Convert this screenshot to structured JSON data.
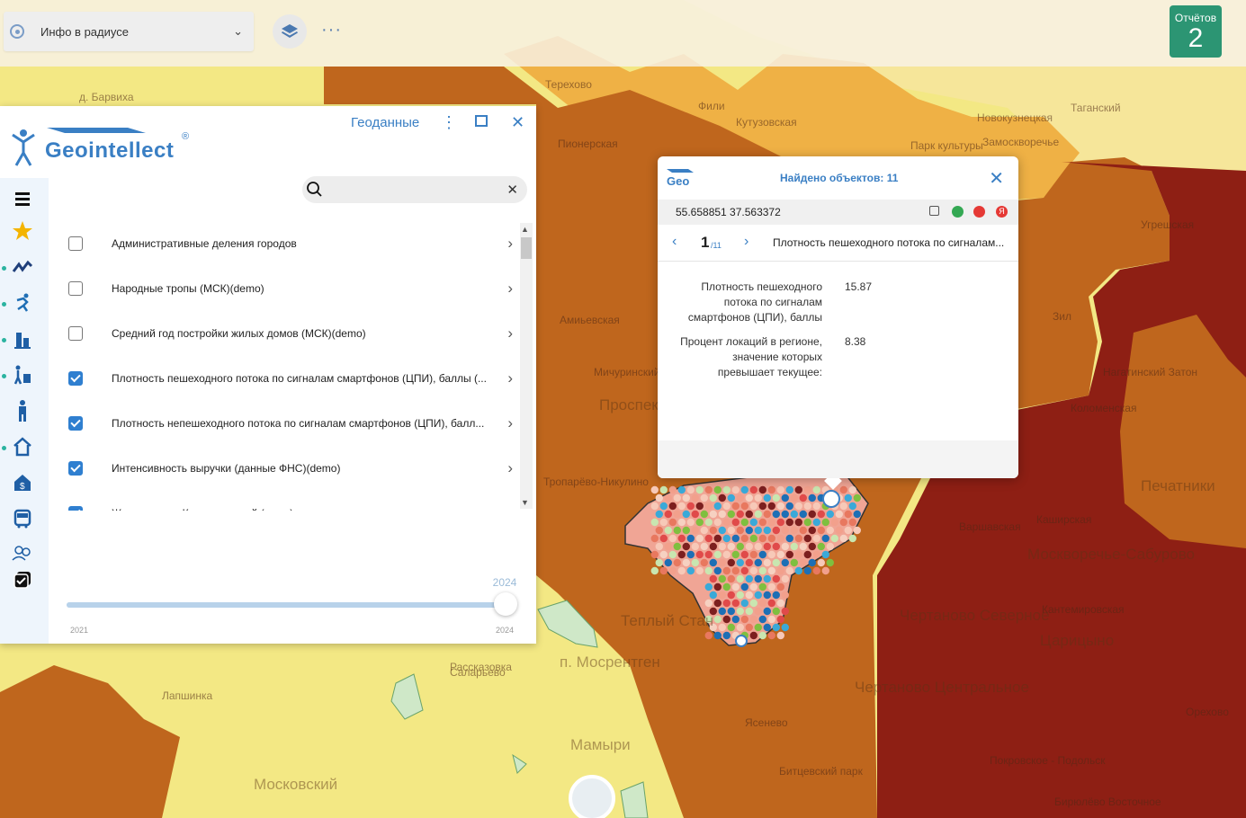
{
  "topbar": {
    "mode_select": {
      "value": "Инфо в радиусе"
    },
    "reports": {
      "label": "Отчётов",
      "count": "2"
    }
  },
  "map": {
    "labels": [
      "д. Барвиха",
      "Терехово",
      "Кутузовская",
      "Фили",
      "Пионерская",
      "Новокузнецкая",
      "Парк культуры",
      "Замоскворечье",
      "Таганский",
      "Амиьевская",
      "Мичуринский проспект",
      "Проспект",
      "Теплый Стан",
      "Рассказовка",
      "Саларьево",
      "п. Мосрентген",
      "Мамыри",
      "Московский",
      "Ясенево",
      "Чертаново Северное",
      "Чертаново Центральное",
      "Варшавская",
      "Москворечье-Сабурово",
      "Каширская",
      "Кантемировская",
      "Царицыно",
      "Печатники",
      "Нагатинский Затон",
      "Коломенская",
      "Бирюлёво Восточное",
      "Лапшинка",
      "Тропарёво-Никулино",
      "Битцевский парк",
      "Зил",
      "Угрешская",
      "Орехово",
      "Покровское - Подольск"
    ]
  },
  "panel": {
    "logo_text": "Geointellect",
    "logo_reg": "®",
    "title": "Геоданные",
    "search": {
      "value": "",
      "placeholder": ""
    },
    "layers": [
      {
        "name": "Административные деления городов",
        "checked": false
      },
      {
        "name": "Народные тропы (МСК)(demo)",
        "checked": false
      },
      {
        "name": "Средний год постройки жилых домов (МСК)(demo)",
        "checked": false
      },
      {
        "name": "Плотность пешеходного потока по сигналам смартфонов (ЦПИ), баллы (...",
        "checked": true
      },
      {
        "name": "Плотность непешеходного потока по сигналам смартфонов (ЦПИ), балл...",
        "checked": true
      },
      {
        "name": "Интенсивность выручки (данные ФНС)(demo)",
        "checked": true
      },
      {
        "name": "Жилые дома. Классы зданий (демо)",
        "checked": true
      }
    ],
    "slider": {
      "min_label": "2021",
      "max_label": "2024",
      "value": "2024",
      "min": 2021,
      "max": 2024,
      "current": 2024
    }
  },
  "popup": {
    "logo": "Geo",
    "found_label": "Найдено объектов: 11",
    "coords": "55.658851 37.563372",
    "page": "1",
    "total": "/11",
    "layer_name": "Плотность пешеходного потока по сигналам...",
    "attributes": [
      {
        "label": "Плотность пешеходного потока по сигналам смартфонов (ЦПИ), баллы",
        "value": "15.87"
      },
      {
        "label": "Процент локаций в регионе, значение которых превышает текущее:",
        "value": "8.38"
      }
    ]
  },
  "colors": {
    "accent": "#3a7fc4",
    "reports_bg": "#2c9573",
    "map_yellow": "#f3e884",
    "map_orange": "#bf661d",
    "map_darkred": "#8e1f14"
  }
}
